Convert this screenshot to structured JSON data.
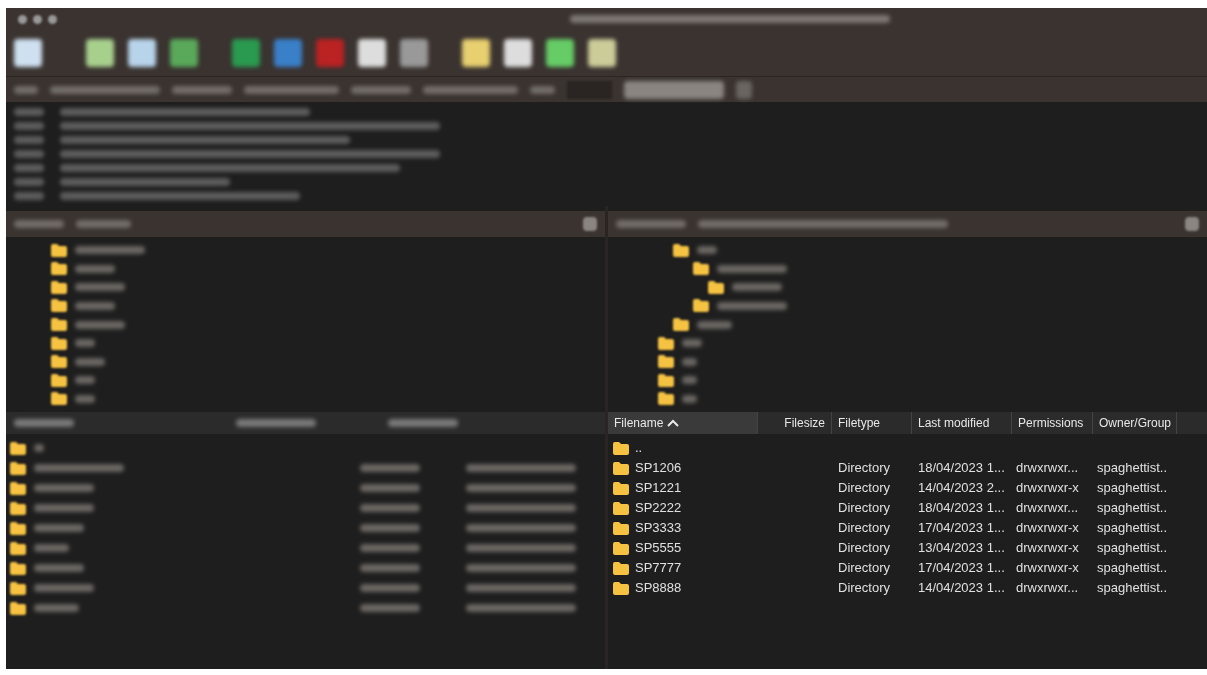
{
  "remote_list": {
    "columns": [
      {
        "label": "Filename",
        "sorted": true
      },
      {
        "label": "Filesize",
        "sorted": false
      },
      {
        "label": "Filetype",
        "sorted": false
      },
      {
        "label": "Last modified",
        "sorted": false
      },
      {
        "label": "Permissions",
        "sorted": false
      },
      {
        "label": "Owner/Group",
        "sorted": false
      }
    ],
    "rows": [
      {
        "name": "..",
        "type": "",
        "modified": "",
        "permissions": "",
        "owner": ""
      },
      {
        "name": "SP1206",
        "type": "Directory",
        "modified": "18/04/2023 1...",
        "permissions": "drwxrwxr...",
        "owner": "spaghettist.."
      },
      {
        "name": "SP1221",
        "type": "Directory",
        "modified": "14/04/2023 2...",
        "permissions": "drwxrwxr-x",
        "owner": "spaghettist.."
      },
      {
        "name": "SP2222",
        "type": "Directory",
        "modified": "18/04/2023 1...",
        "permissions": "drwxrwxr...",
        "owner": "spaghettist.."
      },
      {
        "name": "SP3333",
        "type": "Directory",
        "modified": "17/04/2023 1...",
        "permissions": "drwxrwxr-x",
        "owner": "spaghettist.."
      },
      {
        "name": "SP5555",
        "type": "Directory",
        "modified": "13/04/2023 1...",
        "permissions": "drwxrwxr-x",
        "owner": "spaghettist.."
      },
      {
        "name": "SP7777",
        "type": "Directory",
        "modified": "17/04/2023 1...",
        "permissions": "drwxrwxr-x",
        "owner": "spaghettist.."
      },
      {
        "name": "SP8888",
        "type": "Directory",
        "modified": "14/04/2023 1...",
        "permissions": "drwxrwxr...",
        "owner": "spaghettist.."
      }
    ]
  }
}
